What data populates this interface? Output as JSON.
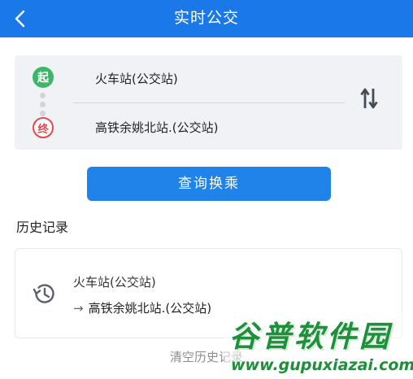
{
  "header": {
    "title": "实时公交"
  },
  "route": {
    "start_badge": "起",
    "end_badge": "终",
    "from": "火车站(公交站)",
    "to": "高铁余姚北站.(公交站)"
  },
  "actions": {
    "query_label": "查询换乘"
  },
  "history": {
    "title": "历史记录",
    "items": [
      {
        "from": "火车站(公交站)",
        "arrow": "→",
        "to": "高铁余姚北站.(公交站)"
      }
    ],
    "clear_label": "清空历史记录"
  },
  "watermark": {
    "brand": "谷普软件园",
    "url": "www.gupuxiazai.com"
  },
  "colors": {
    "primary": "#1a78e8",
    "start_green": "#3bb76a",
    "end_red": "#e6484e",
    "watermark_green": "#1e8f3a"
  }
}
